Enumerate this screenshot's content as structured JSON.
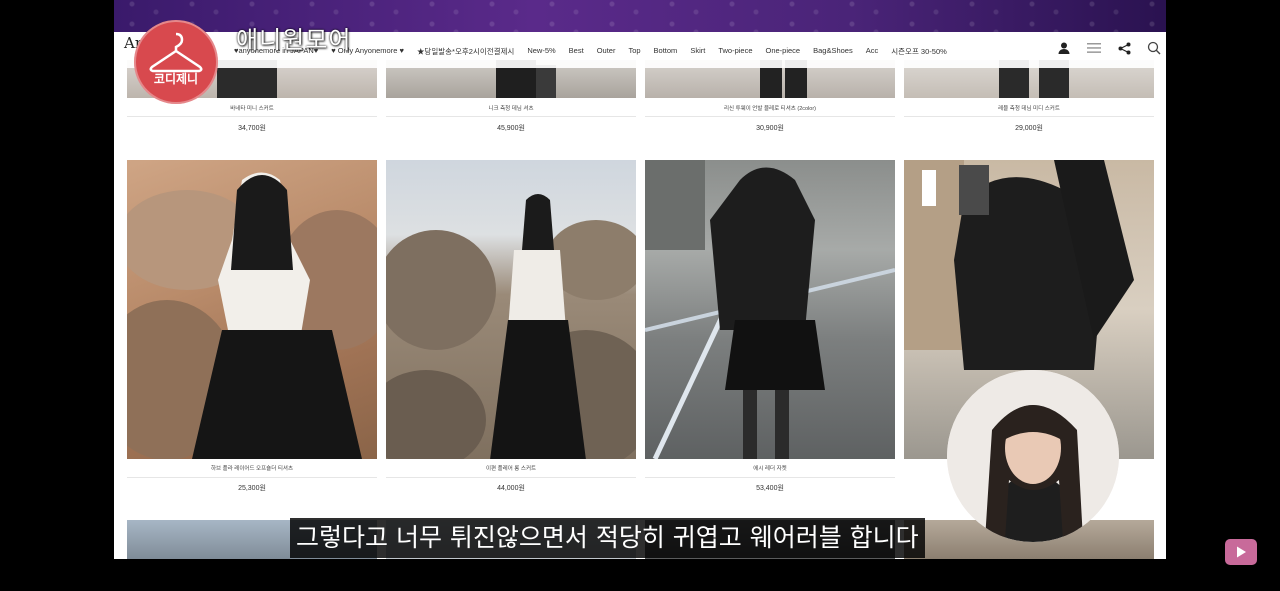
{
  "site": {
    "brand": "An"
  },
  "nav": {
    "items": [
      "♥anyonemore in JAPAN♥",
      "♥ Only Anyonemore ♥",
      "★당일발송*오후2시이전결제시",
      "New-5%",
      "Best",
      "Outer",
      "Top",
      "Bottom",
      "Skirt",
      "Two-piece",
      "One-piece",
      "Bag&Shoes",
      "Acc",
      "시즌오프 30-50%"
    ],
    "icons": [
      "user-icon",
      "menu-icon",
      "share-icon",
      "search-icon"
    ]
  },
  "products_top": [
    {
      "name": "바네타 미니 스커트",
      "price": "34,700원"
    },
    {
      "name": "니크 측청 데님 셔츠",
      "price": "45,900원"
    },
    {
      "name": "리신 투웨이 언발 블레로 티셔츠 (2color)",
      "price": "30,900원"
    },
    {
      "name": "레블 측청 데님 미디 스커트",
      "price": "29,000원"
    }
  ],
  "products_mid": [
    {
      "name": "하브 플라 레이어드 오프숄더 티셔츠",
      "price": "25,300원"
    },
    {
      "name": "이편 플레어 롱 스커트",
      "price": "44,000원"
    },
    {
      "name": "에시 레더 자켓",
      "price": "53,400원"
    },
    {
      "name": "",
      "price": ""
    }
  ],
  "overlay": {
    "badge_text": "코디제니",
    "title": "애니원모어",
    "subtitle": "그렇다고 너무 튀진않으면서 적당히 귀엽고 웨어러블 합니다"
  },
  "colors": {
    "badge": "#d8494e",
    "top_band": "#4a2478",
    "yt_button": "#c86a9a"
  }
}
